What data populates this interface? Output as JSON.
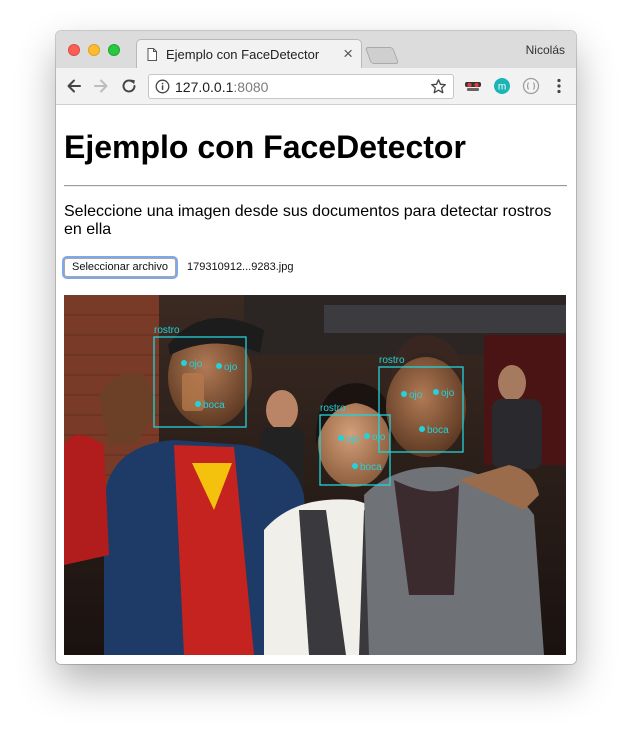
{
  "browser": {
    "tab_title": "Ejemplo con FaceDetector",
    "tab_close": "×",
    "profile_name": "Nicolás",
    "url_host": "127.0.0.1",
    "url_port": ":8080",
    "icons": [
      "back-arrow-icon",
      "forward-arrow-icon",
      "reload-icon",
      "info-icon",
      "star-icon",
      "incognito-extension-icon",
      "m-extension-icon",
      "circle-extension-icon",
      "more-vert-icon"
    ]
  },
  "page": {
    "heading": "Ejemplo con FaceDetector",
    "description": "Seleccione una imagen desde sus documentos para detectar rostros en ella",
    "file_button_label": "Seleccionar archivo",
    "file_name": "179310912...9283.jpg"
  },
  "detection": {
    "color": "#22d3da",
    "face_label": "rostro",
    "eye_label": "ojo",
    "mouth_label": "boca",
    "faces_detected": 3
  }
}
